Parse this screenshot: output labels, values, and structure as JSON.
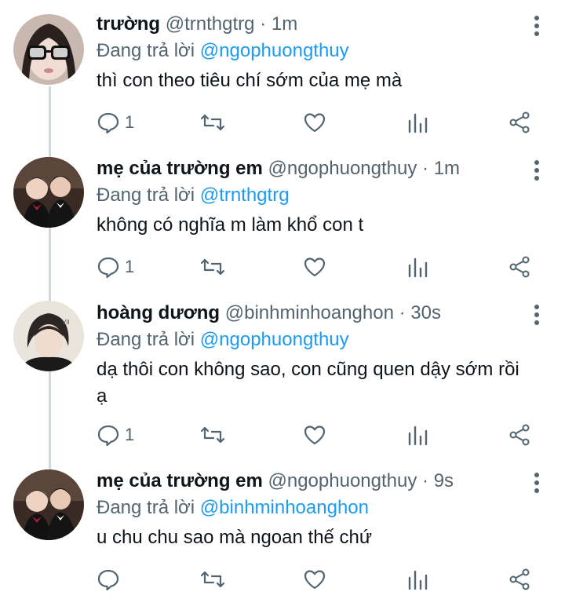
{
  "tweets": [
    {
      "name": "trường",
      "handle": "@trnthgtrg",
      "time": "· 1m",
      "reply_prefix": "Đang trả lời",
      "reply_to": "@ngophuongthuy",
      "text": "thì con theo tiêu chí sớm của mẹ mà",
      "reply_count": "1"
    },
    {
      "name": "mẹ của trường em",
      "handle": "@ngophuongthuy",
      "time": "· 1m",
      "reply_prefix": "Đang trả lời",
      "reply_to": "@trnthgtrg",
      "text": "không có nghĩa m làm khổ con t",
      "reply_count": "1"
    },
    {
      "name": "hoàng dương",
      "handle": "@binhminhoanghon",
      "time": "· 30s",
      "reply_prefix": "Đang trả lời",
      "reply_to": "@ngophuongthuy",
      "text": "dạ thôi con không sao, con cũng quen dậy sớm rồi ạ",
      "reply_count": "1"
    },
    {
      "name": "mẹ của trường em",
      "handle": "@ngophuongthuy",
      "time": "· 9s",
      "reply_prefix": "Đang trả lời",
      "reply_to": "@binhminhoanghon",
      "text": "u chu chu sao mà ngoan thế chứ",
      "reply_count": ""
    }
  ],
  "icons": {
    "reply": "reply-icon",
    "retweet": "retweet-icon",
    "like": "heart-icon",
    "analytics": "analytics-icon",
    "share": "share-icon",
    "more": "more-vertical-icon"
  },
  "colors": {
    "name": "#0f1419",
    "secondary": "#536471",
    "mention": "#1d9bf0",
    "thread_line": "#cfd9de"
  }
}
